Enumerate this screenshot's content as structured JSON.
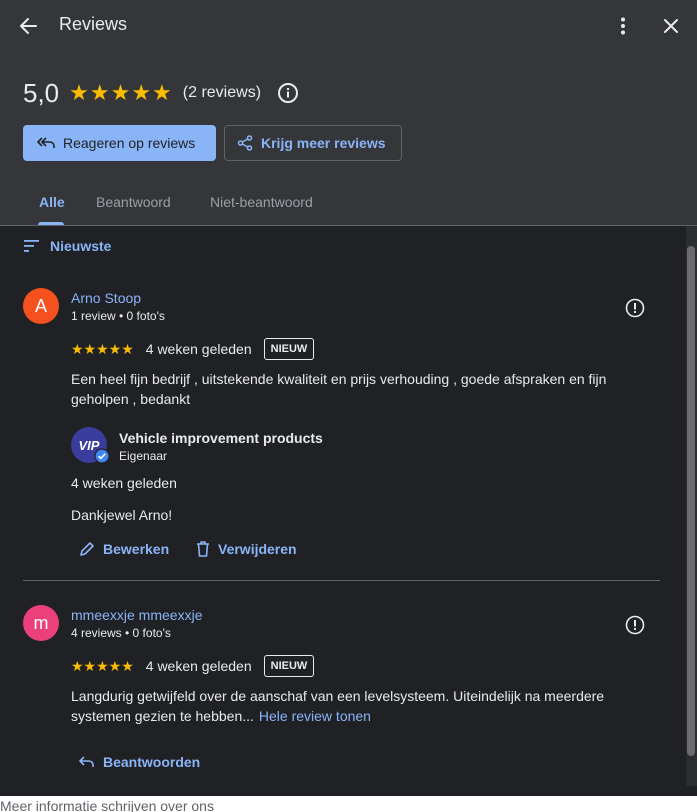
{
  "header": {
    "title": "Reviews",
    "back_icon": "arrow-back-icon",
    "more_icon": "more-vert-icon",
    "close_icon": "close-icon"
  },
  "summary": {
    "rating": "5,0",
    "stars": "★★★★★",
    "count": "(2 reviews)",
    "info_icon": "info-icon"
  },
  "buttons": {
    "reply": "Reageren op reviews",
    "more_reviews": "Krijg meer reviews"
  },
  "tabs": [
    {
      "label": "Alle",
      "active": true
    },
    {
      "label": "Beantwoord",
      "active": false
    },
    {
      "label": "Niet-beantwoord",
      "active": false
    }
  ],
  "sort": {
    "label": "Nieuwste"
  },
  "reviews": [
    {
      "initial": "A",
      "avatar_color": "#f4511e",
      "name": "Arno Stoop",
      "meta": "1 review • 0 foto's",
      "stars": "★★★★★",
      "when": "4 weken geleden",
      "badge": "NIEUW",
      "text": "Een heel fijn bedrijf , uitstekende kwaliteit en prijs verhouding , goede afspraken en fijn geholpen , bedankt",
      "owner_reply": {
        "owner_name": "Vehicle improvement products",
        "owner_role": "Eigenaar",
        "logo_text": "VIP",
        "when": "4 weken geleden",
        "text": "Dankjewel Arno!",
        "edit": "Bewerken",
        "delete": "Verwijderen"
      }
    },
    {
      "initial": "m",
      "avatar_color": "#ec407a",
      "name": "mmeexxje mmeexxje",
      "meta": "4 reviews • 0 foto's",
      "stars": "★★★★★",
      "when": "4 weken geleden",
      "badge": "NIEUW",
      "text": "Langdurig getwijfeld over de aanschaf van een levelsysteem. Uiteindelijk na meerdere systemen gezien te hebben...",
      "more_link": "Hele review tonen",
      "reply": "Beantwoorden"
    }
  ],
  "background_text": "Meer informatie schrijven over ons"
}
